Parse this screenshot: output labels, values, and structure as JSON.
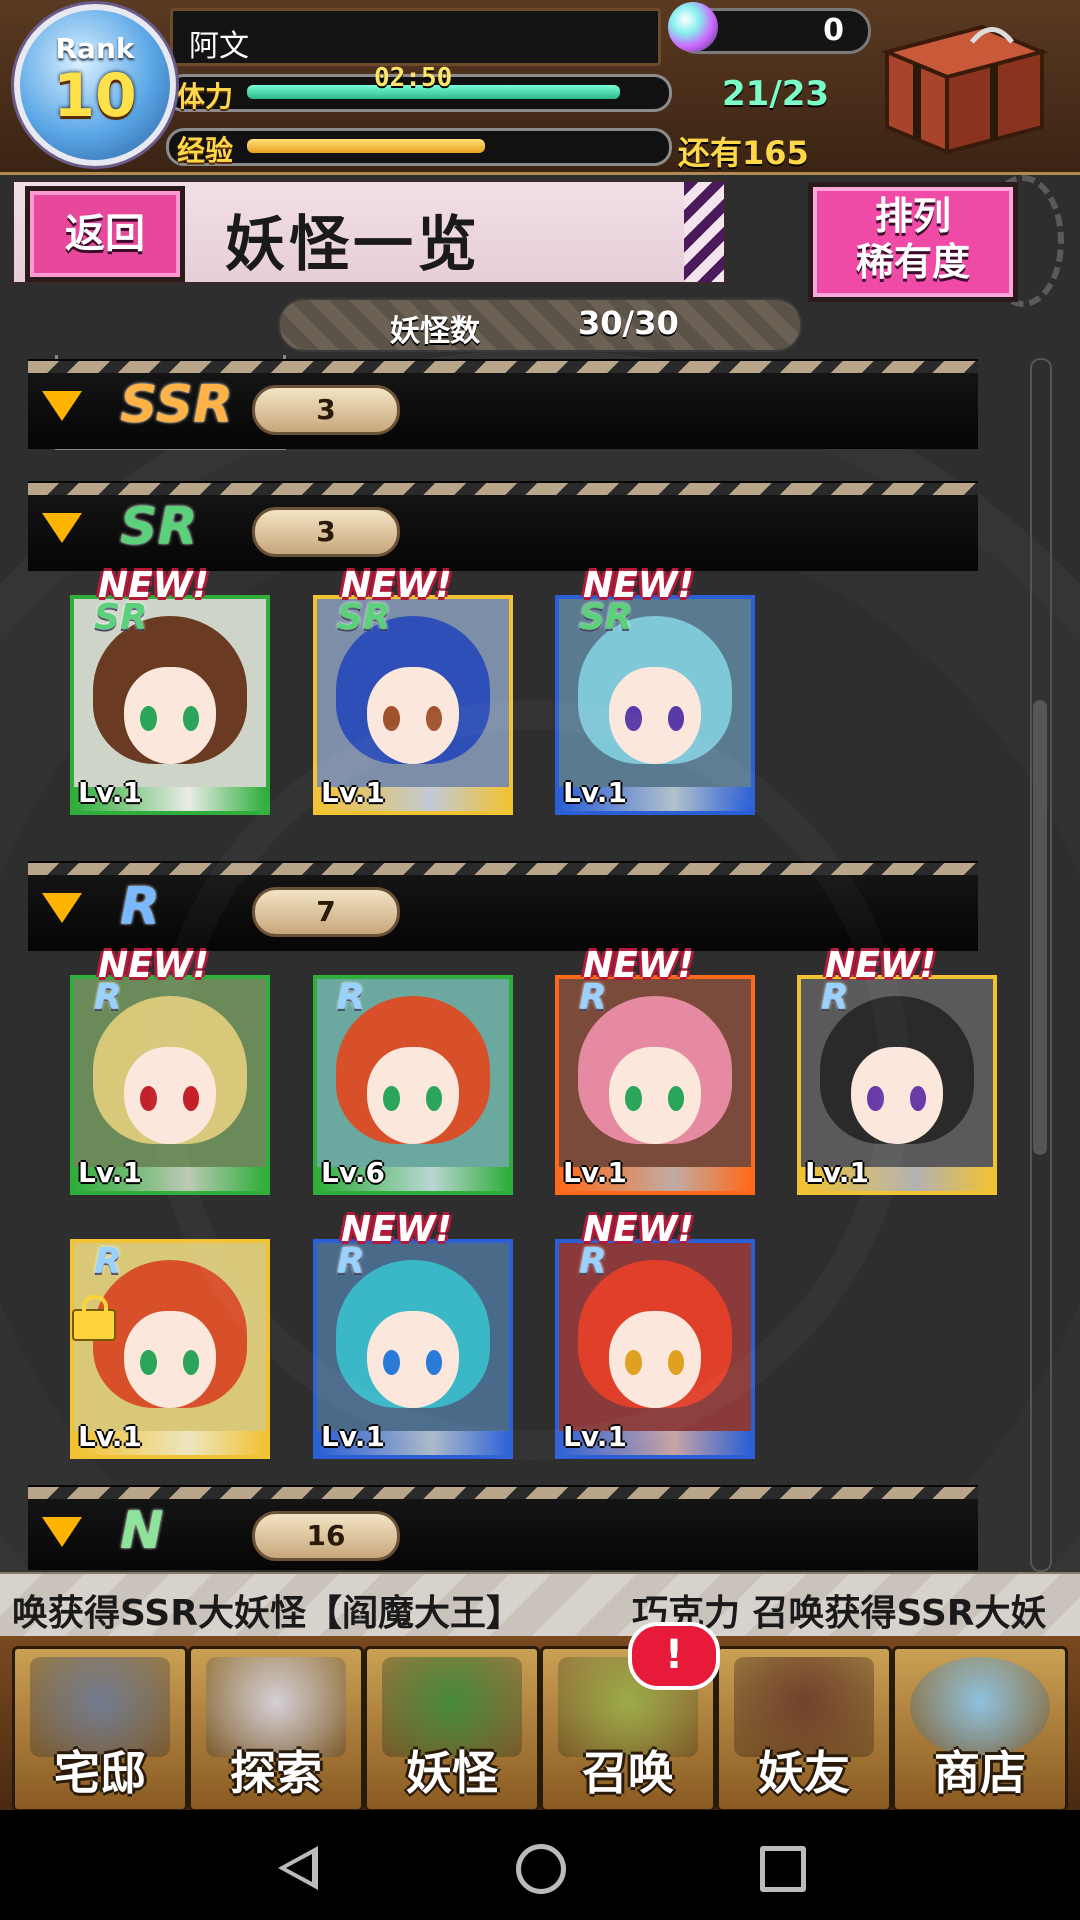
{
  "player": {
    "rank_label": "Rank",
    "rank": "10",
    "name": "阿文",
    "orbs": "0"
  },
  "stamina": {
    "label": "体力",
    "timer": "02:50",
    "value": "21/23",
    "fraction": 0.91
  },
  "exp": {
    "label": "经验",
    "remaining": "还有165",
    "fraction": 0.58
  },
  "header": {
    "back_label": "返回",
    "title": "妖怪一览",
    "sort_line1": "排列",
    "sort_line2": "稀有度"
  },
  "count": {
    "label": "妖怪数",
    "value": "30/30"
  },
  "sections": [
    {
      "rarity": "SSR",
      "count": "3",
      "color": "#ffb347"
    },
    {
      "rarity": "SR",
      "count": "3",
      "color": "#5ad17a"
    },
    {
      "rarity": "R",
      "count": "7",
      "color": "#7ab8ff"
    },
    {
      "rarity": "N",
      "count": "16",
      "color": "#8de39a"
    }
  ],
  "cards": [
    {
      "level": "Lv.1",
      "badge": "NEW!",
      "rarity": "SR",
      "frame": "#2fae3b",
      "hair": "#6a3a22",
      "eye": "#2aa55a",
      "bg": "#cfd4c9"
    },
    {
      "level": "Lv.1",
      "badge": "NEW!",
      "rarity": "SR",
      "frame": "#f1c232",
      "hair": "#2f4fb8",
      "eye": "#a0522d",
      "bg": "#7d8fa8"
    },
    {
      "level": "Lv.1",
      "badge": "NEW!",
      "rarity": "SR",
      "frame": "#2a5fd6",
      "hair": "#7fc8d8",
      "eye": "#5a3aa8",
      "bg": "#5a7a90"
    },
    {
      "level": "Lv.1",
      "badge": "NEW!",
      "rarity": "R",
      "frame": "#2fae3b",
      "hair": "#d8c87a",
      "eye": "#c4202a",
      "bg": "#6a8a5a"
    },
    {
      "level": "Lv.6",
      "badge": "",
      "rarity": "R",
      "frame": "#2fae3b",
      "hair": "#d8502a",
      "eye": "#2aa55a",
      "bg": "#6aa8a0"
    },
    {
      "level": "Lv.1",
      "badge": "NEW!",
      "rarity": "R",
      "frame": "#ff6a1a",
      "hair": "#e58aa0",
      "eye": "#2aa55a",
      "bg": "#7a4a3a"
    },
    {
      "level": "Lv.1",
      "badge": "NEW!",
      "rarity": "R",
      "frame": "#f1c232",
      "hair": "#2a2a2a",
      "eye": "#6a3aa8",
      "bg": "#5a5a5a"
    },
    {
      "level": "Lv.1",
      "badge": "",
      "rarity": "R",
      "frame": "#f1c232",
      "hair": "#d8502a",
      "eye": "#2aa55a",
      "bg": "#d8c878",
      "locked": true
    },
    {
      "level": "Lv.1",
      "badge": "NEW!",
      "rarity": "R",
      "frame": "#2a5fd6",
      "hair": "#3ab8c8",
      "eye": "#2a7ad8",
      "bg": "#4a6a8a"
    },
    {
      "level": "Lv.1",
      "badge": "NEW!",
      "rarity": "R",
      "frame": "#2a5fd6",
      "hair": "#e0402a",
      "eye": "#e0a020",
      "bg": "#8a3a3a"
    }
  ],
  "ticker": {
    "text1": "唤获得SSR大妖怪【阎魔大王】",
    "text2": "巧克力 召唤获得SSR大妖"
  },
  "nav": [
    {
      "label": "宅邸",
      "color": "#6a7a9a"
    },
    {
      "label": "探索",
      "color": "#d8d8e8"
    },
    {
      "label": "妖怪",
      "color": "#3a8a3a"
    },
    {
      "label": "召唤",
      "color": "#9ab04a"
    },
    {
      "label": "妖友",
      "color": "#6a3a2a"
    },
    {
      "label": "商店",
      "color": "#8ac8f0"
    }
  ],
  "alert": "!"
}
